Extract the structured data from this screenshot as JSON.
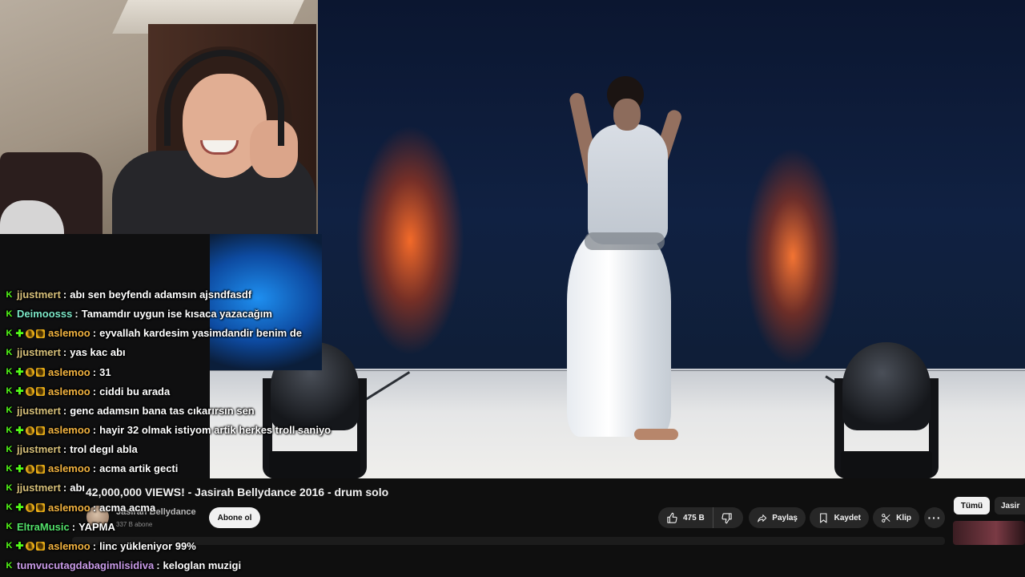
{
  "chat": [
    {
      "user": "jjustmert",
      "color": "#d7c07a",
      "badges": [
        "kick"
      ],
      "text": "abı sen beyfendı adamsın ajsndfasdf"
    },
    {
      "user": "Deimoosss",
      "color": "#7de8c8",
      "badges": [
        "kick"
      ],
      "text": "Tamamdır uygun ise kısaca yazacağım"
    },
    {
      "user": "aslemoo",
      "color": "#f2b340",
      "badges": [
        "kick",
        "plus",
        "coin",
        "crown"
      ],
      "text": "eyvallah kardesim yasimdandir benim de"
    },
    {
      "user": "jjustmert",
      "color": "#d7c07a",
      "badges": [
        "kick"
      ],
      "text": "yas kac abı"
    },
    {
      "user": "aslemoo",
      "color": "#f2b340",
      "badges": [
        "kick",
        "plus",
        "coin",
        "crown"
      ],
      "text": "31"
    },
    {
      "user": "aslemoo",
      "color": "#f2b340",
      "badges": [
        "kick",
        "plus",
        "coin",
        "crown"
      ],
      "text": "ciddi bu arada"
    },
    {
      "user": "jjustmert",
      "color": "#d7c07a",
      "badges": [
        "kick"
      ],
      "text": "genc adamsın bana tas cıkarırsın sen"
    },
    {
      "user": "aslemoo",
      "color": "#f2b340",
      "badges": [
        "kick",
        "plus",
        "coin",
        "crown"
      ],
      "text": "hayir 32 olmak istiyom artik herkes troll saniyo"
    },
    {
      "user": "jjustmert",
      "color": "#d7c07a",
      "badges": [
        "kick"
      ],
      "text": "trol degıl abla"
    },
    {
      "user": "aslemoo",
      "color": "#f2b340",
      "badges": [
        "kick",
        "plus",
        "coin",
        "crown"
      ],
      "text": "acma artik gecti"
    },
    {
      "user": "jjustmert",
      "color": "#d7c07a",
      "badges": [
        "kick"
      ],
      "text": "abı"
    },
    {
      "user": "aslemoo",
      "color": "#f2b340",
      "badges": [
        "kick",
        "plus",
        "coin",
        "crown"
      ],
      "text": "acma acma"
    },
    {
      "user": "EltraMusic",
      "color": "#53e06a",
      "badges": [
        "kick"
      ],
      "text": "YAPMA"
    },
    {
      "user": "aslemoo",
      "color": "#f2b340",
      "badges": [
        "kick",
        "plus",
        "coin",
        "crown"
      ],
      "text": "linc yükleniyor 99%"
    },
    {
      "user": "tumvucutagdabagimlisidiva",
      "color": "#c99be8",
      "badges": [
        "kick"
      ],
      "text": "keloglan muzigi"
    }
  ],
  "video": {
    "title": "42,000,000 VIEWS! - Jasirah Bellydance 2016 - drum solo",
    "channel": "Jasirah Bellydance",
    "subscribers": "337 B abone",
    "subscribe_label": "Abone ol",
    "likes": "475 B",
    "share_label": "Paylaş",
    "save_label": "Kaydet",
    "clip_label": "Klip",
    "more_label": "···"
  },
  "filters": {
    "all": "Tümü",
    "channel": "Jasir"
  },
  "colors": {
    "accent_green": "#53fc18",
    "badge_gold": "#f2b318",
    "youtube_bg": "#0f0f0f",
    "pill_bg": "#272727"
  },
  "icons": {
    "kick": "kick-badge-icon",
    "plus": "plus-badge-icon",
    "coin": "coin-badge-icon",
    "crown": "crown-badge-icon",
    "like": "thumbs-up-icon",
    "dislike": "thumbs-down-icon",
    "share": "share-icon",
    "save": "bookmark-icon",
    "clip": "scissors-icon"
  }
}
